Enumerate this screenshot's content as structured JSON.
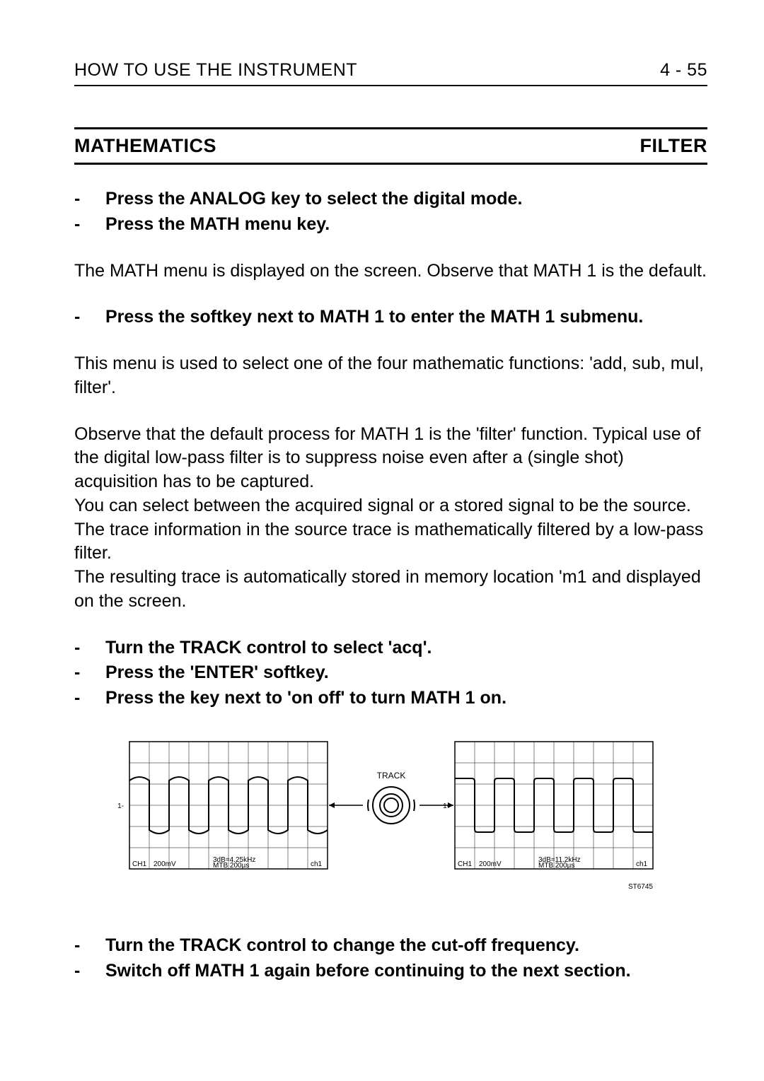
{
  "header": {
    "left": "HOW TO USE THE INSTRUMENT",
    "right": "4 - 55"
  },
  "section": {
    "left": "MATHEMATICS",
    "right": "FILTER"
  },
  "bullets_a": [
    "Press the ANALOG key to select the digital mode.",
    "Press the MATH menu key."
  ],
  "para_a": "The MATH menu is displayed on the screen. Observe that MATH 1 is the default.",
  "bullet_b": "Press the softkey next to MATH 1 to enter the MATH 1 submenu.",
  "para_b": "This menu is used to select one of the four mathematic functions: 'add, sub, mul, filter'.",
  "para_c": "Observe that the default process for MATH 1 is the 'filter' function. Typical use of the digital low-pass filter is to suppress noise even after a (single shot) acquisition has to be captured.",
  "para_d": "You can select between the acquired signal or a stored signal to be the source.",
  "para_e": "The trace information in the source trace is mathematically filtered by a low-pass filter.",
  "para_f": "The resulting trace is automatically stored in memory location 'm1 and displayed on the screen.",
  "bullets_c": [
    "Turn the TRACK control to select 'acq'.",
    "Press the 'ENTER' softkey.",
    "Press the key next to 'on off' to turn MATH 1 on."
  ],
  "bullets_d": [
    "Turn the TRACK control to change the cut-off frequency.",
    "Switch off MATH 1 again before continuing to the next section."
  ],
  "figure": {
    "knob_label": "TRACK",
    "code": "ST6745",
    "left": {
      "ch": "CH1",
      "scale": "200mV",
      "cutoff": "3dB=4.25kHz",
      "tb": "MTB 200µs",
      "trig": "ch1"
    },
    "right": {
      "ch": "CH1",
      "scale": "200mV",
      "cutoff": "3dB=11.2kHz",
      "tb": "MTB 200µs",
      "trig": "ch1"
    }
  }
}
